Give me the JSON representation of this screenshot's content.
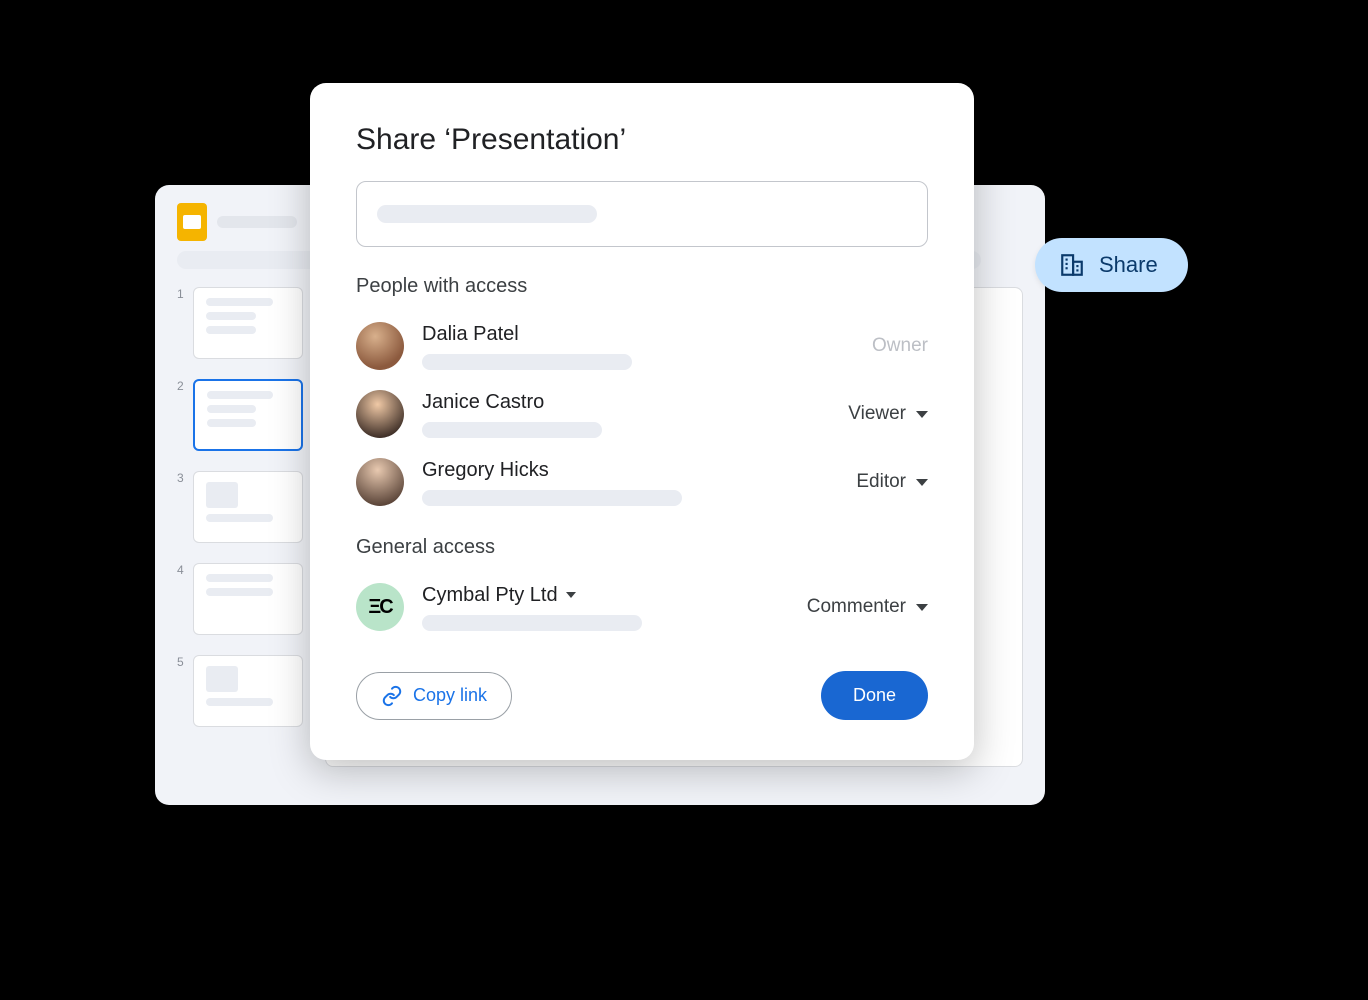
{
  "share_pill": {
    "label": "Share"
  },
  "slides": {
    "thumbs": [
      {
        "num": "1"
      },
      {
        "num": "2"
      },
      {
        "num": "3"
      },
      {
        "num": "4"
      },
      {
        "num": "5"
      }
    ]
  },
  "dialog": {
    "title": "Share ‘Presentation’",
    "people_label": "People with access",
    "general_label": "General access",
    "people": [
      {
        "name": "Dalia Patel",
        "role": "Owner",
        "role_editable": false
      },
      {
        "name": "Janice Castro",
        "role": "Viewer",
        "role_editable": true
      },
      {
        "name": "Gregory Hicks",
        "role": "Editor",
        "role_editable": true
      }
    ],
    "general": {
      "org_name": "Cymbal Pty Ltd",
      "org_badge": "ΞC",
      "role": "Commenter"
    },
    "copy_link": "Copy link",
    "done": "Done"
  }
}
